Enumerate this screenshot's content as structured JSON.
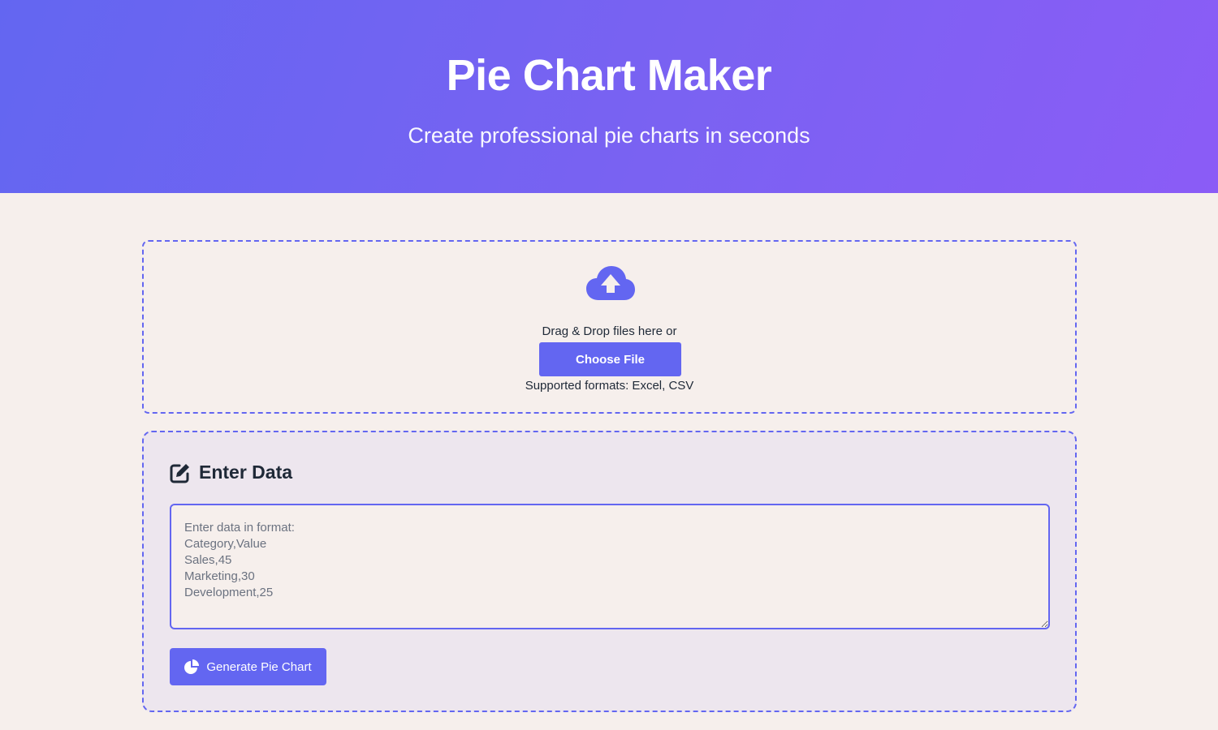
{
  "header": {
    "title": "Pie Chart Maker",
    "subtitle": "Create professional pie charts in seconds"
  },
  "upload": {
    "icon": "cloud-upload-icon",
    "drop_text": "Drag & Drop files here or",
    "choose_label": "Choose File",
    "formats_text": "Supported formats: Excel, CSV"
  },
  "data_entry": {
    "icon": "edit-icon",
    "title": "Enter Data",
    "value": "",
    "placeholder": "Enter data in format:\nCategory,Value\nSales,45\nMarketing,30\nDevelopment,25",
    "generate_label": "Generate Pie Chart",
    "generate_icon": "pie-chart-icon"
  },
  "colors": {
    "accent": "#6366f1",
    "gradient_end": "#8b5cf6",
    "background": "#f6efec"
  }
}
